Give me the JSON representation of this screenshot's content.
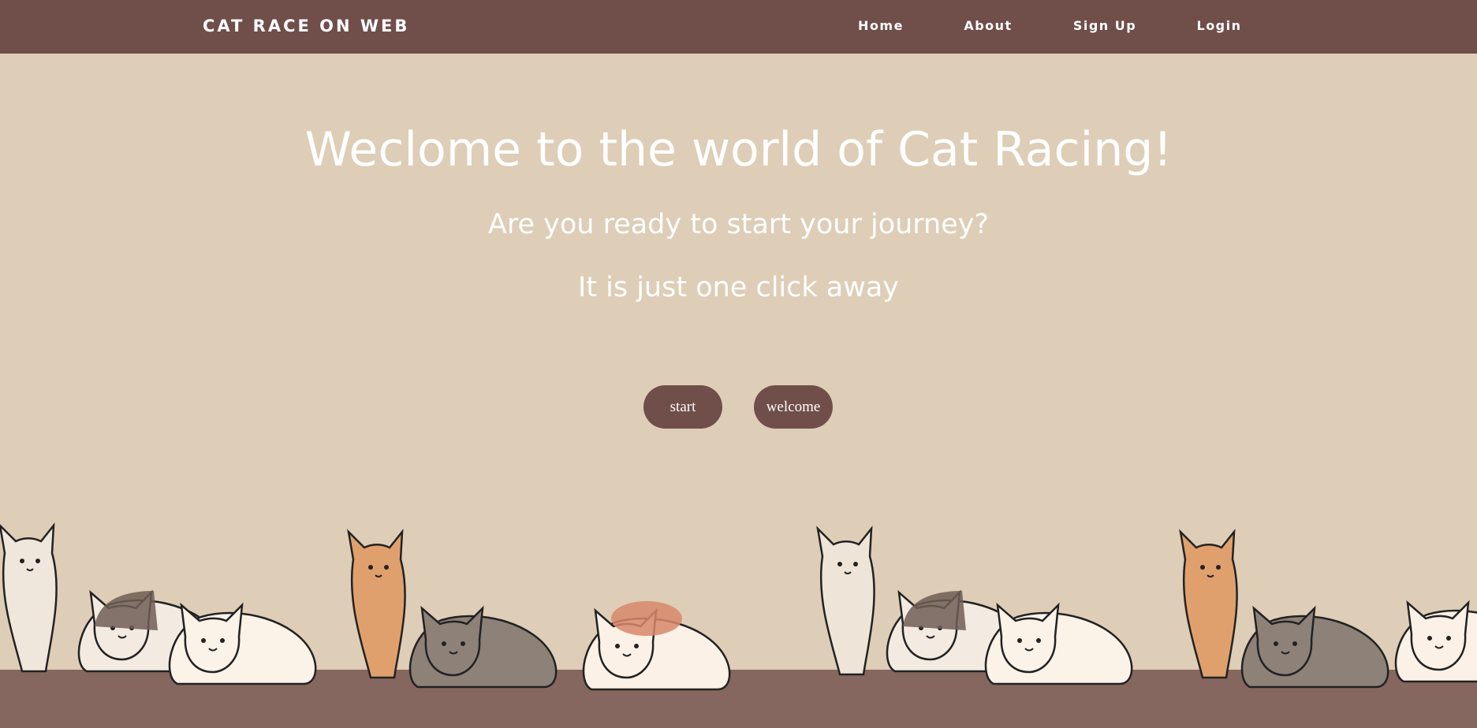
{
  "nav": {
    "brand": "CAT RACE ON WEB",
    "links": [
      {
        "label": "Home"
      },
      {
        "label": "About"
      },
      {
        "label": "Sign Up"
      },
      {
        "label": "Login"
      }
    ]
  },
  "hero": {
    "title": "Weclome to the world of Cat Racing!",
    "subtitle": "Are you ready to start your journey?",
    "tagline": "It is just one click away"
  },
  "buttons": {
    "start_label": "start",
    "welcome_label": "welcome"
  },
  "colors": {
    "navbar": "#704e4a",
    "background": "#decdb7",
    "floor": "#866760",
    "button": "#704e4a",
    "text": "#ffffff"
  },
  "illustration": {
    "icon": "cat-row-illustration"
  }
}
